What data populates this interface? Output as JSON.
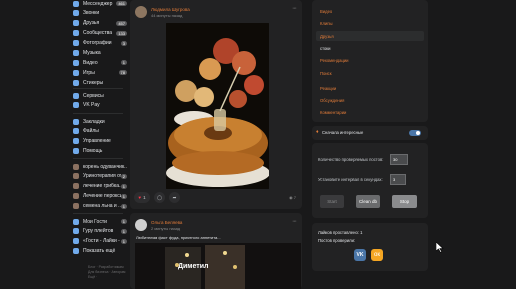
{
  "sidebar": {
    "items": [
      {
        "label": "Мессенджер",
        "count": "461"
      },
      {
        "label": "Звонки",
        "count": ""
      },
      {
        "label": "Друзья",
        "count": "457"
      },
      {
        "label": "Сообщества",
        "count": "133"
      },
      {
        "label": "Фотографии",
        "count": "3"
      },
      {
        "label": "Музыка",
        "count": ""
      },
      {
        "label": "Видео",
        "count": "1"
      },
      {
        "label": "Игры",
        "count": "78"
      },
      {
        "label": "Стикеры",
        "count": ""
      }
    ],
    "items2": [
      {
        "label": "Сервисы",
        "count": ""
      },
      {
        "label": "VK Pay",
        "count": ""
      }
    ],
    "items3": [
      {
        "label": "Закладки",
        "count": ""
      },
      {
        "label": "Файлы",
        "count": ""
      },
      {
        "label": "Управление",
        "count": ""
      },
      {
        "label": "Помощь",
        "count": ""
      }
    ],
    "groups": [
      {
        "label": "корень одуванчик...",
        "count": ""
      },
      {
        "label": "Уринотерапия отз...",
        "count": "2"
      },
      {
        "label": "лечение грибка...",
        "count": "1"
      },
      {
        "label": "Лечение пероксид...",
        "count": "1"
      },
      {
        "label": "семена льна и ...",
        "count": "1"
      }
    ],
    "bottom": [
      {
        "label": "Мои Гости",
        "count": "1"
      },
      {
        "label": "Гуру плейтов",
        "count": "1"
      },
      {
        "label": "«Гости - Лайки - К...",
        "count": "1"
      },
      {
        "label": "Показать ещё",
        "count": ""
      }
    ],
    "footer": [
      "Блог · Разработчикам",
      "Для бизнеса · Авторам",
      "Ещё ·"
    ]
  },
  "post1": {
    "author": "Людмила Шугрова",
    "time": "44 минуты назад",
    "likes": "1",
    "views": "7"
  },
  "post2": {
    "author": "Ольга Беляева",
    "time": "2 минуты назад",
    "text": "Любителям фаст фуда, приятного аппетита...",
    "photo_caption": "Диметил"
  },
  "filters": {
    "items": [
      "Видео",
      "Клипы",
      "Друзья",
      "стоки",
      "Рекомендации",
      "Поиск",
      "Реакции",
      "Обсуждения",
      "Комментарии"
    ]
  },
  "toggle": {
    "label": "Сначала интересные",
    "enabled": true
  },
  "controls": {
    "count_label": "Количество проверяемых постов:",
    "count_value": "30",
    "interval_label": "Установите интервал в секундах:",
    "interval_value": "3",
    "start_label": "Start",
    "clean_label": "Clean db",
    "stop_label": "Stop"
  },
  "stats": {
    "likes_label": "Лайков проставлено: 1",
    "checked_label": "Постов проверили:"
  },
  "colors": {
    "accent": "#e07b39",
    "vk_blue": "#4a76a8",
    "ok_orange": "#f5a623"
  }
}
